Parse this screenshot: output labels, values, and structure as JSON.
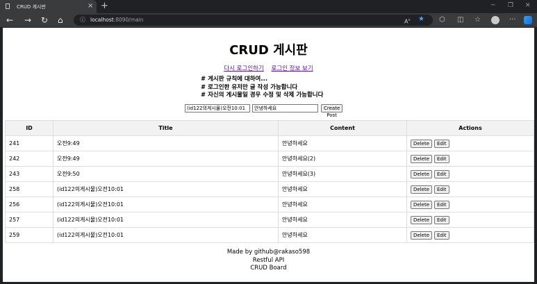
{
  "browser": {
    "tab_title": "CRUD 게시판",
    "new_tab": "+",
    "url_host": "localhost",
    "url_path": ":8090/main"
  },
  "page": {
    "title": "CRUD 게시판",
    "links": [
      "다시 로그인하기",
      "로그인 정보 보기"
    ],
    "rules": [
      "# 게시판 규칙에 대하여...",
      "# 로그인한 유저만 글 작성 가능합니다",
      "# 자신의 게시물일 경우 수정 및 삭제 가능합니다"
    ],
    "form": {
      "title_value": "(id122의게시물)오전10:01",
      "content_value": "안녕하세요",
      "create_label": "Create Post"
    },
    "table": {
      "headers": [
        "ID",
        "Title",
        "Content",
        "Actions"
      ],
      "delete_label": "Delete",
      "edit_label": "Edit",
      "rows": [
        {
          "id": "241",
          "title": "오전9:49",
          "content": "안녕하세요"
        },
        {
          "id": "242",
          "title": "오전9:49",
          "content": "안녕하세요(2)"
        },
        {
          "id": "243",
          "title": "오전9:50",
          "content": "안녕하세요(3)"
        },
        {
          "id": "258",
          "title": "(id122의게시물)오전10:01",
          "content": "안녕하세요"
        },
        {
          "id": "256",
          "title": "(id122의게시물)오전10:01",
          "content": "안녕하세요"
        },
        {
          "id": "257",
          "title": "(id122의게시물)오전10:01",
          "content": "안녕하세요"
        },
        {
          "id": "259",
          "title": "(id122의게시물)오전10:01",
          "content": "안녕하세요"
        }
      ]
    },
    "footer": [
      "Made by github@rakaso598",
      "Restful API",
      "CRUD Board"
    ]
  }
}
